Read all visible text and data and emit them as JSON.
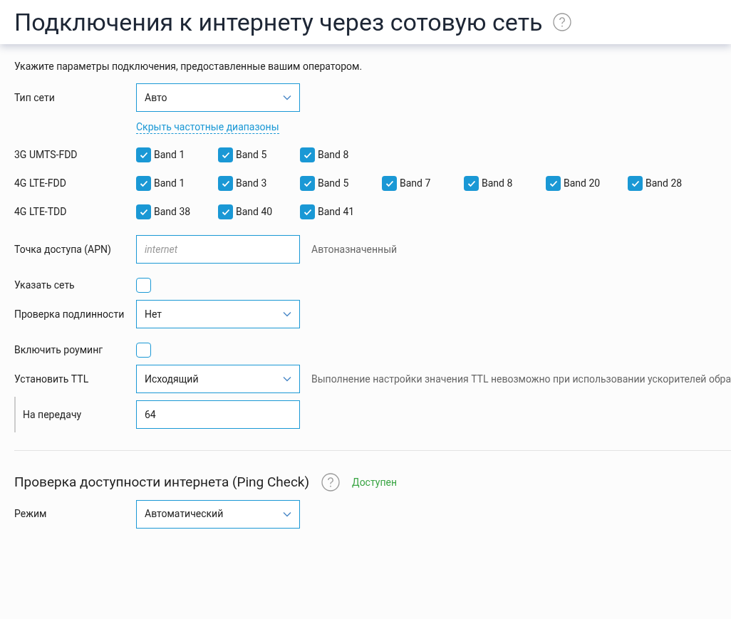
{
  "header": {
    "title": "Подключения к интернету через сотовую сеть"
  },
  "intro": "Укажите параметры подключения, предоставленные вашим оператором.",
  "rows": [
    {
      "kind": "select",
      "label": "Тип сети",
      "value": "Авто"
    },
    {
      "kind": "link",
      "text": "Скрыть частотные диапазоны"
    },
    {
      "kind": "bands",
      "label": "3G UMTS-FDD",
      "bands": [
        {
          "label": "Band 1",
          "checked": true
        },
        {
          "label": "Band 5",
          "checked": true
        },
        {
          "label": "Band 8",
          "checked": true
        }
      ]
    },
    {
      "kind": "bands",
      "label": "4G LTE-FDD",
      "bands": [
        {
          "label": "Band 1",
          "checked": true
        },
        {
          "label": "Band 3",
          "checked": true
        },
        {
          "label": "Band 5",
          "checked": true
        },
        {
          "label": "Band 7",
          "checked": true
        },
        {
          "label": "Band 8",
          "checked": true
        },
        {
          "label": "Band 20",
          "checked": true
        },
        {
          "label": "Band 28",
          "checked": true
        }
      ]
    },
    {
      "kind": "bands",
      "label": "4G LTE-TDD",
      "bands": [
        {
          "label": "Band 38",
          "checked": true
        },
        {
          "label": "Band 40",
          "checked": true
        },
        {
          "label": "Band 41",
          "checked": true
        }
      ]
    },
    {
      "kind": "input",
      "label": "Точка доступа (APN)",
      "placeholder": "internet",
      "note": "Автоназначенный"
    },
    {
      "kind": "checkbox",
      "label": "Указать сеть",
      "checked": false
    },
    {
      "kind": "select",
      "label": "Проверка подлинности",
      "value": "Нет"
    },
    {
      "kind": "checkbox",
      "label": "Включить роуминг",
      "checked": false
    },
    {
      "kind": "select",
      "label": "Установить TTL",
      "value": "Исходящий",
      "note": "Выполнение настройки значения TTL невозможно при использовании ускорителей обра"
    },
    {
      "kind": "subinput",
      "label": "На передачу",
      "value": "64"
    }
  ],
  "ping": {
    "title": "Проверка доступности интернета (Ping Check)",
    "status": "Доступен",
    "rows": [
      {
        "kind": "select",
        "label": "Режим",
        "value": "Автоматический"
      }
    ]
  }
}
